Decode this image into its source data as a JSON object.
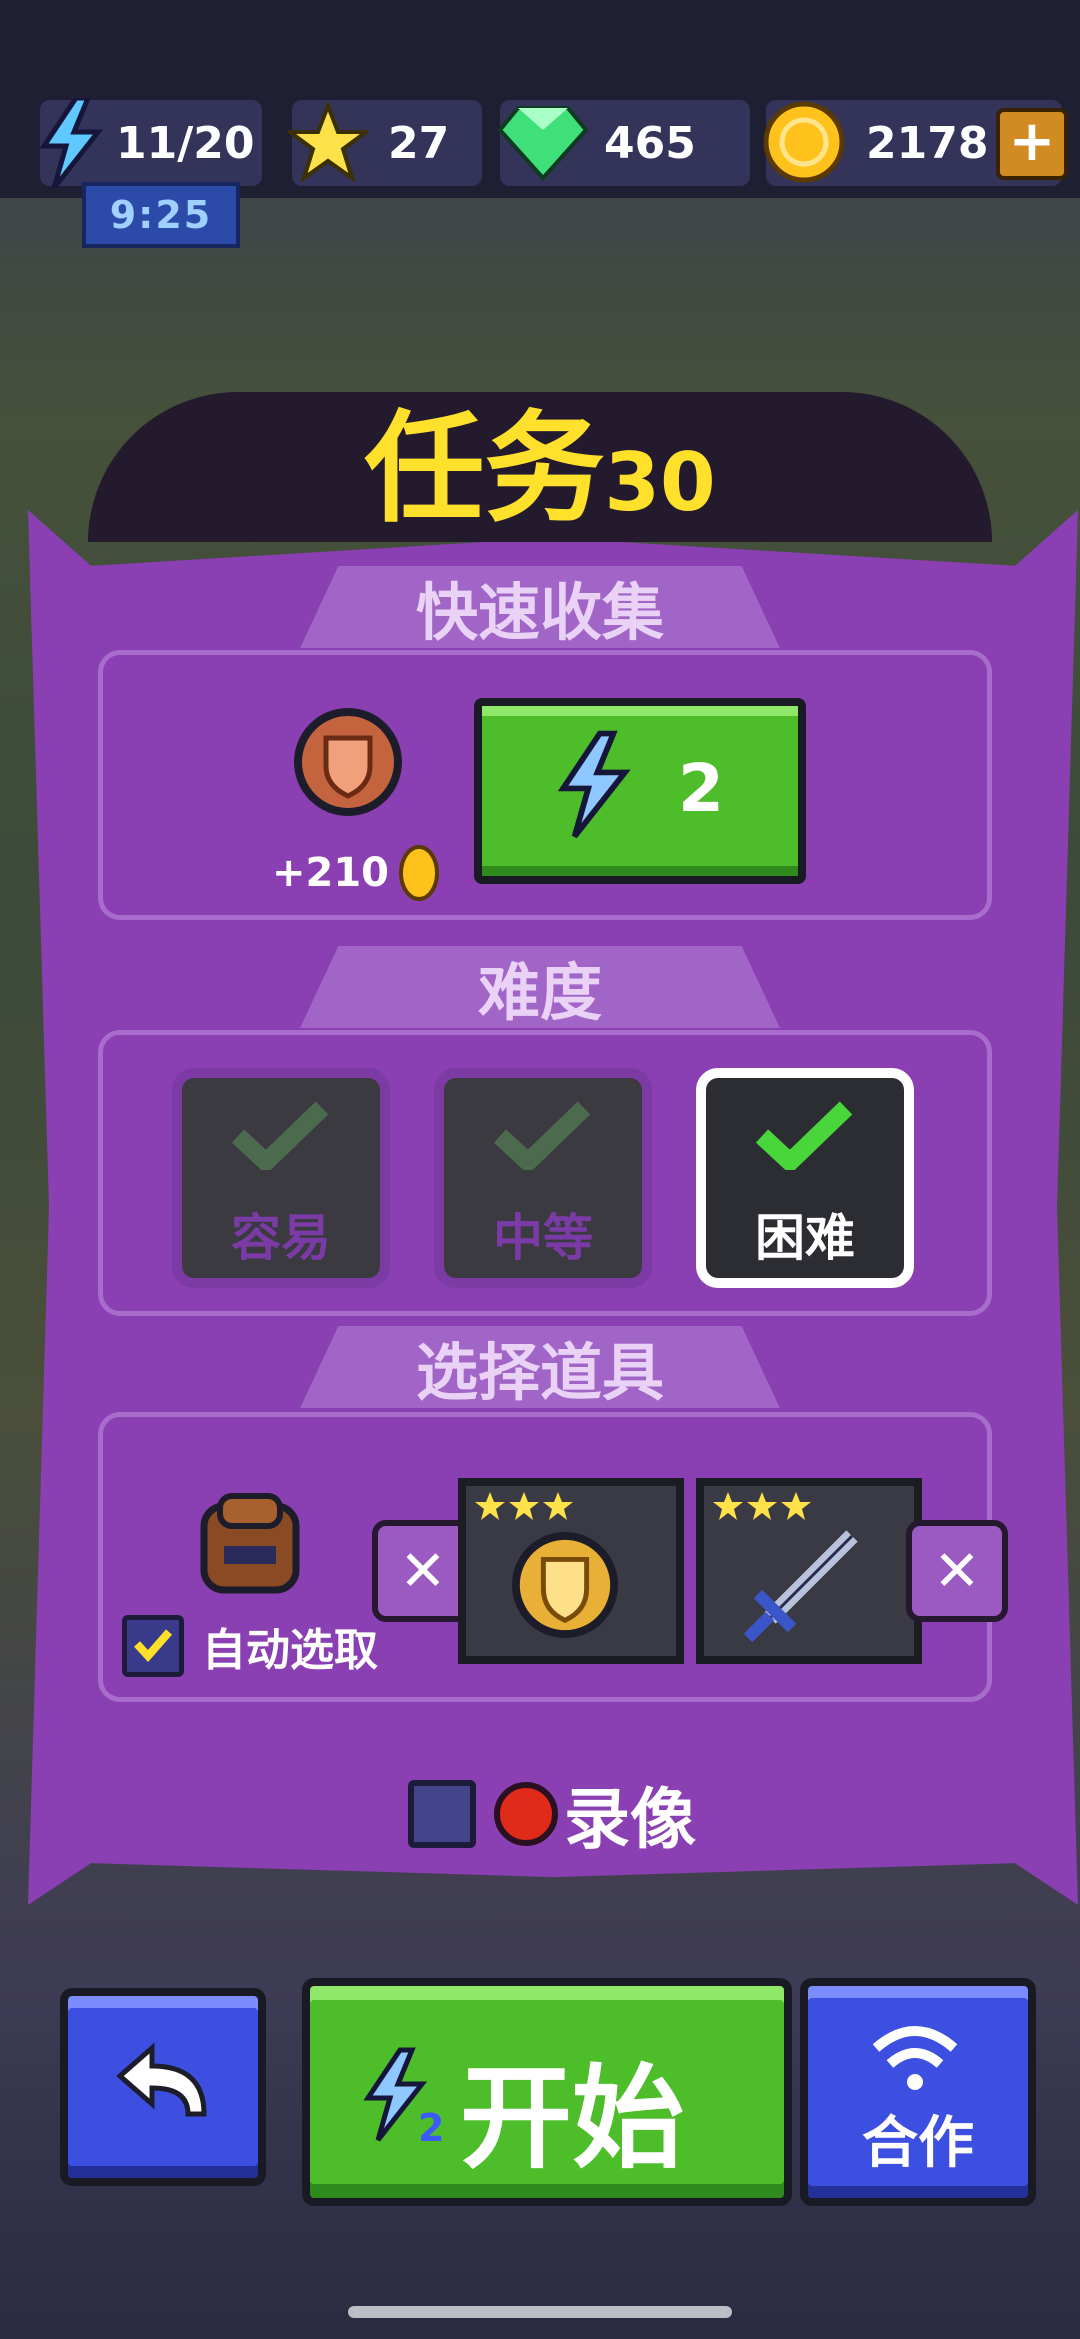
{
  "hud": {
    "energy": "11/20",
    "timer": "9:25",
    "stars": "27",
    "gems": "465",
    "coins": "2178"
  },
  "title": {
    "text": "任务",
    "number": "30"
  },
  "quick_collect": {
    "heading": "快速收集",
    "reward": "+210",
    "cost": "2"
  },
  "difficulty": {
    "heading": "难度",
    "options": [
      "容易",
      "中等",
      "困难"
    ],
    "selected": "困难"
  },
  "items": {
    "heading": "选择道具",
    "auto_select_label": "自动选取",
    "auto_select_checked": true
  },
  "record": {
    "label": "录像"
  },
  "actions": {
    "start_label": "开始",
    "start_cost": "2",
    "coop_label": "合作"
  },
  "colors": {
    "panel": "#8a3fb3",
    "title": "#ffe02a",
    "start": "#4dbd29",
    "coop": "#3c4fe0"
  }
}
